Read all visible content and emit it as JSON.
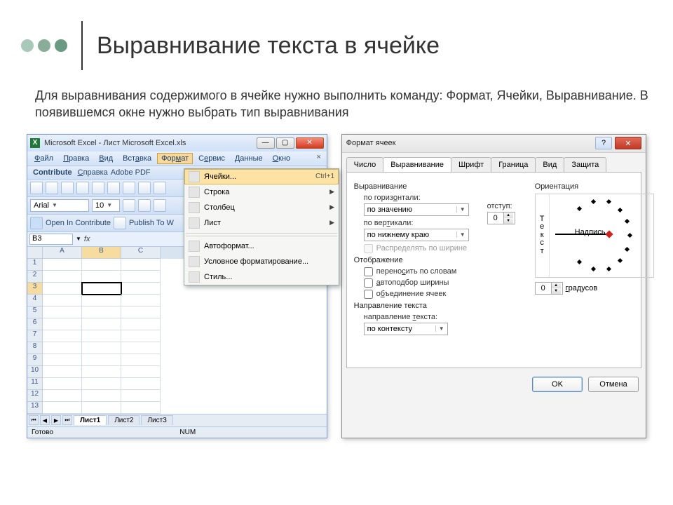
{
  "slide": {
    "title": "Выравнивание текста в ячейке",
    "body": "Для выравнивания содержимого в ячейке нужно выполнить команду: Формат, Ячейки, Выравнивание. В появившемся окне нужно выбрать тип выравнивания"
  },
  "excel": {
    "app_icon": "X",
    "window_title": "Microsoft Excel - Лист Microsoft Excel.xls",
    "window_buttons": {
      "min": "—",
      "max": "▢",
      "close": "✕"
    },
    "menubar": [
      "Файл",
      "Правка",
      "Вид",
      "Вставка",
      "Формат",
      "Сервис",
      "Данные",
      "Окно"
    ],
    "menubar_highlight": "Формат",
    "doc_close": "×",
    "toolbars": {
      "contribute": "Contribute",
      "spravka": "Справка",
      "adobe": "Adobe PDF",
      "font": "Arial",
      "size": "10",
      "open_contrib": "Open In Contribute",
      "publish": "Publish To W"
    },
    "name_box": "B3",
    "fx_label": "fx",
    "columns": [
      "A",
      "B",
      "C"
    ],
    "rows": [
      "1",
      "2",
      "3",
      "4",
      "5",
      "6",
      "7",
      "8",
      "9",
      "10",
      "11",
      "12",
      "13"
    ],
    "active_col": "B",
    "active_row": "3",
    "sheet_tabs": [
      "Лист1",
      "Лист2",
      "Лист3"
    ],
    "nav": [
      "⏮",
      "◀",
      "▶",
      "⏭"
    ],
    "status_ready": "Готово",
    "status_num": "NUM"
  },
  "format_menu": {
    "items": [
      {
        "label": "Ячейки...",
        "shortcut": "Ctrl+1",
        "submenu": false,
        "highlight": true
      },
      {
        "label": "Строка",
        "shortcut": "",
        "submenu": true
      },
      {
        "label": "Столбец",
        "shortcut": "",
        "submenu": true
      },
      {
        "label": "Лист",
        "shortcut": "",
        "submenu": true
      },
      {
        "label": "Автоформат...",
        "shortcut": "",
        "submenu": false
      },
      {
        "label": "Условное форматирование...",
        "shortcut": "",
        "submenu": false
      },
      {
        "label": "Стиль...",
        "shortcut": "",
        "submenu": false
      }
    ]
  },
  "dialog": {
    "title": "Формат ячеек",
    "help": "?",
    "close": "✕",
    "tabs": [
      "Число",
      "Выравнивание",
      "Шрифт",
      "Граница",
      "Вид",
      "Защита"
    ],
    "active_tab": "Выравнивание",
    "grp_align": "Выравнивание",
    "h_label": "по горизонтали:",
    "h_value": "по значению",
    "indent_label": "отступ:",
    "indent_value": "0",
    "v_label": "по вертикали:",
    "v_value": "по нижнему краю",
    "distribute": "Распределять по ширине",
    "grp_display": "Отображение",
    "wrap": "переносить по словам",
    "autofit": "автоподбор ширины",
    "merge": "объединение ячеек",
    "grp_textdir": "Направление текста",
    "dir_label": "направление текста:",
    "dir_value": "по контексту",
    "grp_orient": "Ориентация",
    "orient_v_text": "Текст",
    "orient_label": "Надпись",
    "degrees_value": "0",
    "degrees_label": "градусов",
    "ok": "OK",
    "cancel": "Отмена"
  }
}
